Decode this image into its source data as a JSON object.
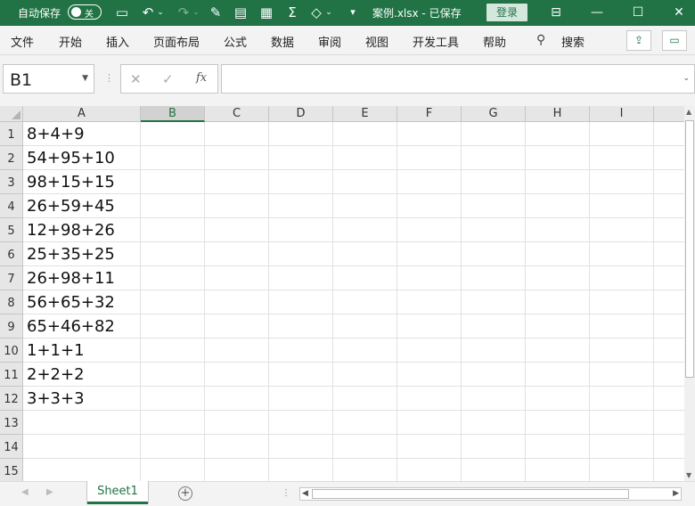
{
  "title_bar": {
    "autosave_label": "自动保存",
    "autosave_toggle": "关",
    "filename": "案例.xlsx  -  已保存",
    "login_label": "登录"
  },
  "ribbon": {
    "tabs": [
      "文件",
      "开始",
      "插入",
      "页面布局",
      "公式",
      "数据",
      "审阅",
      "视图",
      "开发工具",
      "帮助"
    ],
    "search_label": "搜索"
  },
  "formula_bar": {
    "name_box": "B1",
    "fx_label": "fx",
    "formula": ""
  },
  "grid": {
    "columns": [
      "A",
      "B",
      "C",
      "D",
      "E",
      "F",
      "G",
      "H",
      "I"
    ],
    "selected_column": "B",
    "rows": [
      "1",
      "2",
      "3",
      "4",
      "5",
      "6",
      "7",
      "8",
      "9",
      "10",
      "11",
      "12",
      "13",
      "14",
      "15"
    ],
    "column_a_values": [
      "8+4+9",
      "54+95+10",
      "98+15+15",
      "26+59+45",
      "12+98+26",
      "25+35+25",
      "26+98+11",
      "56+65+32",
      "65+46+82",
      "1+1+1",
      "2+2+2",
      "3+3+3",
      "",
      "",
      ""
    ]
  },
  "sheets": {
    "tabs": [
      "Sheet1"
    ],
    "active": "Sheet1"
  },
  "colors": {
    "accent": "#217346",
    "header_bg": "#e6e6e6",
    "ribbon_bg": "#f3f3f3"
  }
}
